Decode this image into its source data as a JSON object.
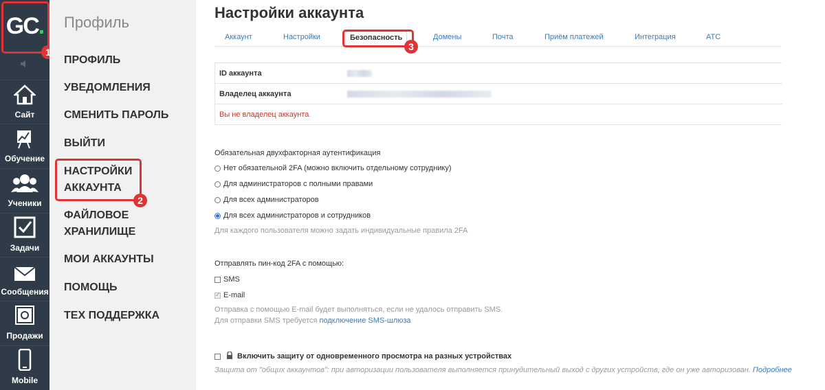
{
  "brand": {
    "logo_text": "GC",
    "logo_dot": ".",
    "accent": "#3ec96b"
  },
  "leftnav": {
    "items": [
      {
        "label": "Сайт",
        "icon": "home-icon"
      },
      {
        "label": "Обучение",
        "icon": "chart-board-icon"
      },
      {
        "label": "Ученики",
        "icon": "users-icon"
      },
      {
        "label": "Задачи",
        "icon": "checkbox-icon"
      },
      {
        "label": "Сообщения",
        "icon": "envelope-icon"
      },
      {
        "label": "Продажи",
        "icon": "safe-icon"
      },
      {
        "label": "Mobile",
        "icon": "phone-icon"
      }
    ]
  },
  "badges": {
    "one": "1",
    "two": "2",
    "three": "3"
  },
  "profile": {
    "title": "Профиль",
    "menu": [
      "ПРОФИЛЬ",
      "УВЕДОМЛЕНИЯ",
      "СМЕНИТЬ ПАРОЛЬ",
      "ВЫЙТИ",
      "НАСТРОЙКИ АККАУНТА",
      "ФАЙЛОВОЕ ХРАНИЛИЩЕ",
      "МОИ АККАУНТЫ",
      "ПОМОЩЬ",
      "ТЕХ ПОДДЕРЖКА"
    ],
    "menu_split": {
      "settings_line1": "НАСТРОЙКИ",
      "settings_line2": "АККАУНТА",
      "storage_line1": "ФАЙЛОВОЕ",
      "storage_line2": "ХРАНИЛИЩЕ"
    }
  },
  "page": {
    "title": "Настройки аккаунта",
    "tabs": [
      "Аккаунт",
      "Настройки",
      "Безопасность",
      "Домены",
      "Почта",
      "Приём платежей",
      "Интеграция",
      "АТС"
    ],
    "active_tab": "Безопасность"
  },
  "account": {
    "id_label": "ID аккаунта",
    "owner_label": "Владелец аккаунта",
    "warning": "Вы не владелец аккаунта"
  },
  "twofa": {
    "heading": "Обязательная двухфакторная аутентификация",
    "options": [
      "Нет обязательной 2FA (можно включить отдельному сотруднику)",
      "Для администраторов с полными правами",
      "Для всех администраторов",
      "Для всех администраторов и сотрудников"
    ],
    "selected_index": 3,
    "hint": "Для каждого пользователя можно задать индивидуальные правила 2FA"
  },
  "pin": {
    "heading": "Отправлять пин-код 2FA с помощью:",
    "sms_label": "SMS",
    "email_label": "E-mail",
    "note1": "Отправка с помощью E-mail будет выполняться, если не удалось отправить SMS.",
    "note2_prefix": "Для отправки SMS требуется ",
    "note2_link": "подключение SMS-шлюза"
  },
  "protect": {
    "label": "Включить защиту от одновременного просмотра на разных устройствах",
    "desc": "Защита от \"общих аккаунтов\": при авторизации пользователя выполняется принудительный выход с других устройств, где он уже авторизован.",
    "more_link": "Подробнее"
  }
}
